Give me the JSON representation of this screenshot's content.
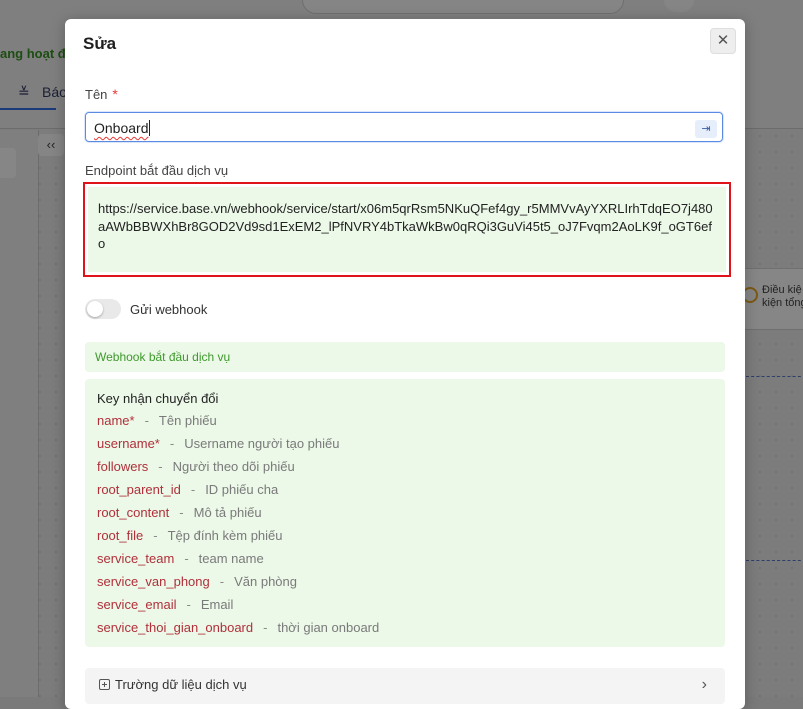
{
  "background": {
    "status_text": "ang hoạt độ",
    "tab_label": "Báo"
  },
  "modal": {
    "title": "Sửa",
    "close_glyph": "✕",
    "name_field": {
      "label": "Tên",
      "required_mark": "*",
      "value": "Onboard"
    },
    "endpoint": {
      "label": "Endpoint bắt đầu dịch vụ",
      "url": "https://service.base.vn/webhook/service/start/x06m5qrRsm5NKuQFef4gy_r5MMVvAyYXRLIrhTdqEO7j480aAWbBBWXhBr8GOD2Vd9sd1ExEM2_lPfNVRY4bTkaWkBw0qRQi3GuVi45t5_oJ7Fvqm2AoLK9f_oGT6efo"
    },
    "webhook_toggle": {
      "label": "Gửi webhook",
      "on": false
    },
    "webhook_start_label": "Webhook bắt đầu dịch vụ",
    "keys": {
      "title": "Key nhận chuyển đổi",
      "separator": "-",
      "items": [
        {
          "key": "name*",
          "desc": "Tên phiếu"
        },
        {
          "key": "username*",
          "desc": "Username người tạo phiếu"
        },
        {
          "key": "followers",
          "desc": "Người theo dõi phiếu"
        },
        {
          "key": "root_parent_id",
          "desc": "ID phiếu cha"
        },
        {
          "key": "root_content",
          "desc": "Mô tả phiếu"
        },
        {
          "key": "root_file",
          "desc": "Tệp đính kèm phiếu"
        },
        {
          "key": "service_team",
          "desc": "team name"
        },
        {
          "key": "service_van_phong",
          "desc": "Văn phòng"
        },
        {
          "key": "service_email",
          "desc": "Email"
        },
        {
          "key": "service_thoi_gian_onboard",
          "desc": "thời gian onboard"
        }
      ]
    },
    "service_fields_label": "Trường dữ liệu dịch vụ",
    "chevron_glyph": "›"
  },
  "right_panel": {
    "line1": "Điều kiệ",
    "line2": "kiện tổng"
  },
  "colors": {
    "highlight_border": "#e0131b",
    "green_panel": "#ecf8e8",
    "key_red": "#b0303a",
    "green_text": "#3e9a2c"
  }
}
